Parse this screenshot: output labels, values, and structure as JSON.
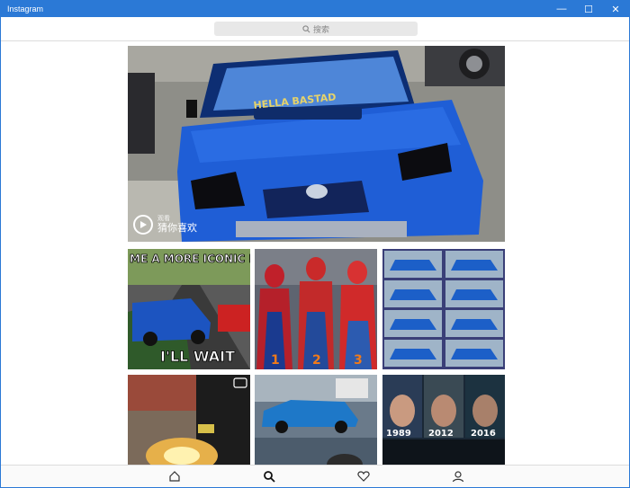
{
  "window": {
    "title": "Instagram",
    "minimize": "—",
    "maximize": "☐",
    "close": "✕"
  },
  "search": {
    "placeholder": "搜索"
  },
  "hero": {
    "label_small": "观看",
    "label_main": "猜你喜欢",
    "plate": "HELLA BASTAD"
  },
  "grid": {
    "meme": {
      "top": "ME A MORE ICONIC D",
      "bottom": "I'LL WAIT"
    },
    "spiderman": {
      "labels": [
        "1",
        "2",
        "3"
      ]
    },
    "batman": {
      "years": [
        "1989",
        "2012",
        "2016"
      ]
    }
  },
  "nav": {
    "items": [
      "home-icon",
      "search-icon",
      "heart-icon",
      "profile-icon"
    ]
  },
  "colors": {
    "titlebar": "#2b79d6",
    "accent_car": "#1c56c9"
  }
}
